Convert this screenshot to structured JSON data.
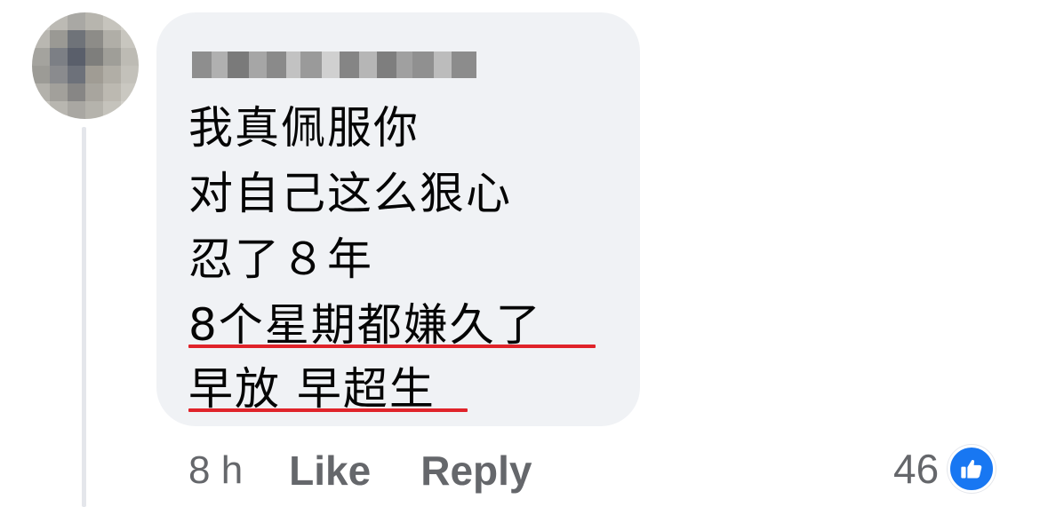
{
  "comment": {
    "author_blurred": true,
    "lines": [
      "我真佩服你",
      "对自己这么狠心",
      "忍了８年",
      "8个星期都嫌久了",
      "早放 早超生"
    ],
    "highlight_color": "#e0232a"
  },
  "actions": {
    "time": "8 h",
    "like_label": "Like",
    "reply_label": "Reply"
  },
  "reactions": {
    "count": "46",
    "icon": "thumbs-up-icon",
    "icon_color": "#1877f2"
  },
  "colors": {
    "bubble": "#f0f2f5",
    "secondary_text": "#65676b",
    "thread_line": "#e4e6eb"
  }
}
